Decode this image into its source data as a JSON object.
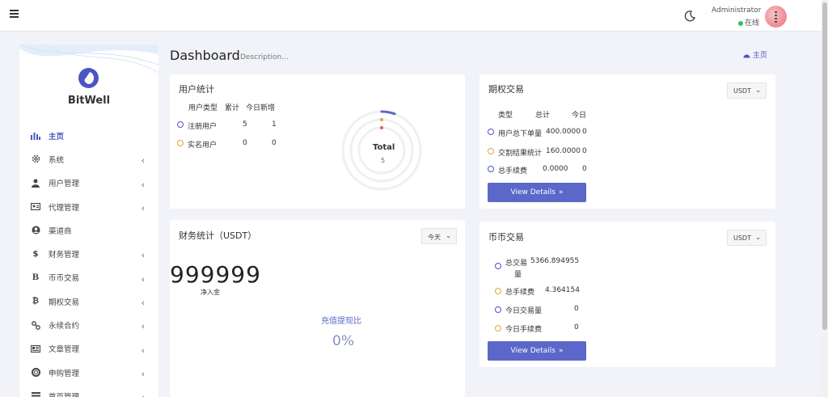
{
  "header": {
    "admin_name": "Administrator",
    "admin_status": "在线",
    "menu_icon": "hamburger-icon",
    "theme_icon": "moon-icon"
  },
  "sidebar": {
    "brand": "BitWell",
    "items": [
      {
        "label": "主页",
        "icon": "bar-chart-icon",
        "active": true,
        "has_children": false
      },
      {
        "label": "系统",
        "icon": "gear-icon",
        "has_children": true
      },
      {
        "label": "用户管理",
        "icon": "user-tie-icon",
        "has_children": true
      },
      {
        "label": "代理管理",
        "icon": "id-card-icon",
        "has_children": true
      },
      {
        "label": "渠道商",
        "icon": "user-circle-icon",
        "has_children": false
      },
      {
        "label": "财务管理",
        "icon": "dollar-icon",
        "has_children": true
      },
      {
        "label": "币币交易",
        "icon": "bitcoin-icon",
        "has_children": true
      },
      {
        "label": "期权交易",
        "icon": "bitcoin-small-icon",
        "has_children": true
      },
      {
        "label": "永续合约",
        "icon": "link-icon",
        "has_children": true
      },
      {
        "label": "文章管理",
        "icon": "newspaper-icon",
        "has_children": true
      },
      {
        "label": "申购管理",
        "icon": "life-ring-icon",
        "has_children": true
      },
      {
        "label": "首页管理",
        "icon": "list-icon",
        "has_children": true
      }
    ]
  },
  "page": {
    "title": "Dashboard",
    "description": "Description...",
    "breadcrumb": "主页"
  },
  "user_stats": {
    "title": "用户统计",
    "headers": [
      "用户类型",
      "累计",
      "今日新增"
    ],
    "rows": [
      {
        "type": "注册用户",
        "total": "5",
        "today": "1"
      },
      {
        "type": "实名用户",
        "total": "0",
        "today": "0"
      }
    ],
    "donut_label": "Total",
    "donut_value": "5",
    "colors": {
      "accent": "#5b68c9",
      "orange": "#e4a43a",
      "red": "#e05a4e"
    }
  },
  "options_trade": {
    "title": "期权交易",
    "currency": "USDT",
    "headers": [
      "类型",
      "总计",
      "今日"
    ],
    "rows": [
      {
        "type": "用户总下单量",
        "total": "400.0000",
        "today": "0"
      },
      {
        "type": "交割结果统计",
        "total": "160.0000",
        "today": "0"
      },
      {
        "type": "总手续费",
        "total": "0.0000",
        "today": "0"
      }
    ],
    "button": "View Details"
  },
  "finance_stats": {
    "title": "财务统计（USDT）",
    "period": "今天",
    "net_value": "999999",
    "net_label": "净入金",
    "ratio_label": "充值提现比",
    "ratio_value": "0%"
  },
  "coin_trade": {
    "title": "币币交易",
    "currency": "USDT",
    "rows": [
      {
        "label_line1": "总交易",
        "value": "5366.894955",
        "label_line2": "量"
      },
      {
        "label_line1": "总手续费",
        "value": "4.364154"
      },
      {
        "label_line1": "今日交易量",
        "value": "0"
      },
      {
        "label_line1": "今日手续费",
        "value": "0"
      }
    ],
    "button": "View Details"
  }
}
